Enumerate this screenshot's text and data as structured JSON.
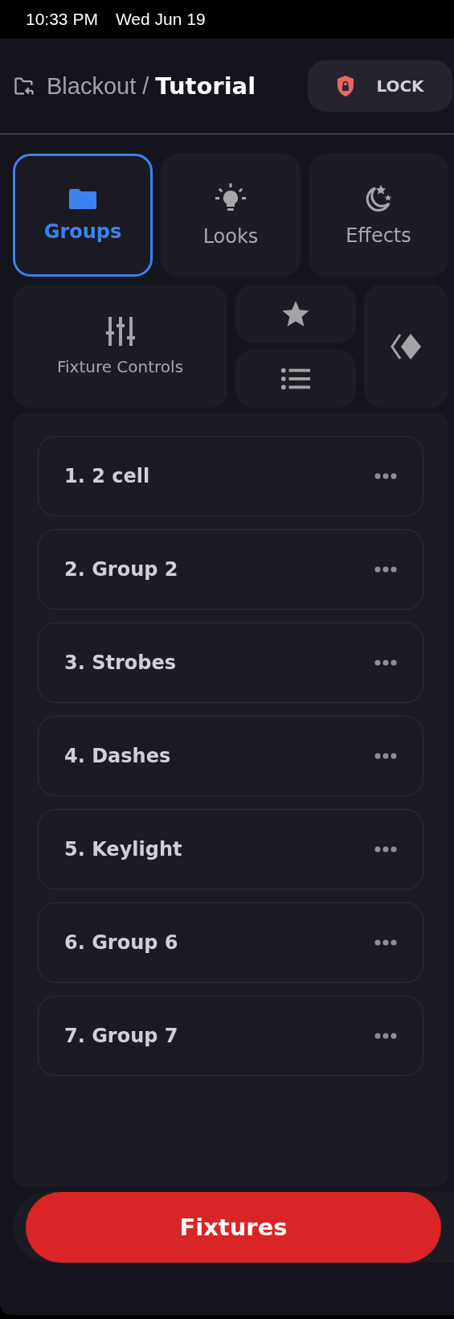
{
  "status_bar": {
    "time": "10:33 PM",
    "date": "Wed Jun 19"
  },
  "header": {
    "project": "Blackout /",
    "show": "Tutorial",
    "lock_button": "LOCK"
  },
  "mode_tabs": [
    {
      "label": "Groups",
      "selected": true
    },
    {
      "label": "Looks",
      "selected": false
    },
    {
      "label": "Effects",
      "selected": false
    }
  ],
  "tools": {
    "fixture_controls": "Fixture Controls"
  },
  "groups": [
    {
      "label": "1. 2 cell"
    },
    {
      "label": "2. Group 2"
    },
    {
      "label": "3. Strobes"
    },
    {
      "label": "4. Dashes"
    },
    {
      "label": "5. Keylight"
    },
    {
      "label": "6. Group 6"
    },
    {
      "label": "7. Group 7"
    }
  ],
  "bottom_button": "Fixtures"
}
